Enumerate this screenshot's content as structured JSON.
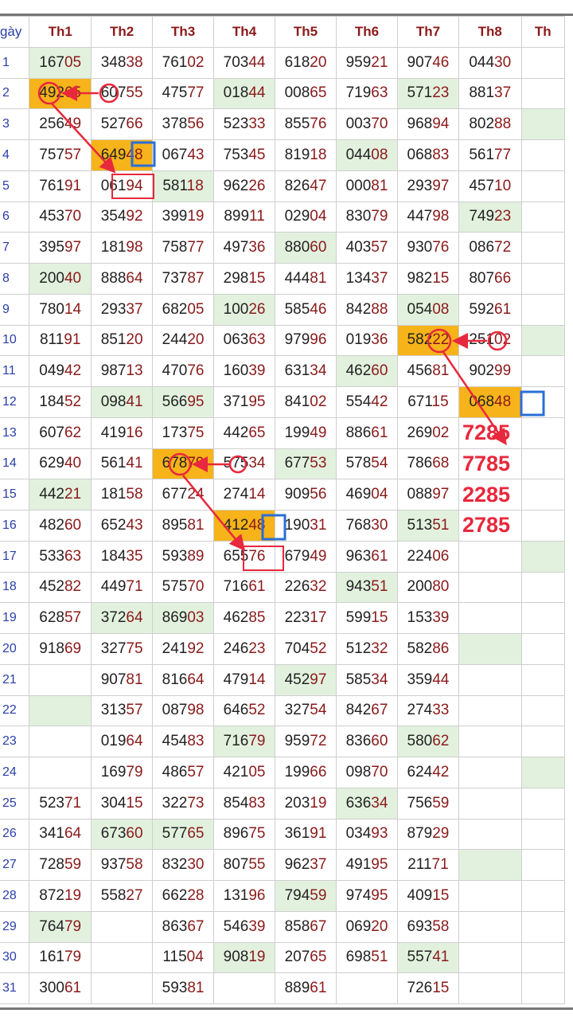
{
  "header": {
    "day_label": "gày",
    "months": [
      "Th1",
      "Th2",
      "Th3",
      "Th4",
      "Th5",
      "Th6",
      "Th7",
      "Th8",
      "Th"
    ]
  },
  "rows": [
    {
      "day": "1",
      "cells": [
        "16705",
        "34838",
        "76102",
        "70344",
        "61820",
        "95921",
        "90746",
        "04430",
        ""
      ]
    },
    {
      "day": "2",
      "cells": [
        "49265",
        "60755",
        "47577",
        "01844",
        "00865",
        "71963",
        "57123",
        "88137",
        ""
      ]
    },
    {
      "day": "3",
      "cells": [
        "25649",
        "52766",
        "37856",
        "52333",
        "85576",
        "00370",
        "96894",
        "80288",
        ""
      ]
    },
    {
      "day": "4",
      "cells": [
        "75757",
        "64948",
        "06743",
        "75345",
        "81918",
        "04408",
        "06883",
        "56177",
        ""
      ]
    },
    {
      "day": "5",
      "cells": [
        "76191",
        "06194",
        "58118",
        "96226",
        "82647",
        "00081",
        "29397",
        "45710",
        ""
      ]
    },
    {
      "day": "6",
      "cells": [
        "45370",
        "35492",
        "39919",
        "89911",
        "02904",
        "83079",
        "44798",
        "74923",
        ""
      ]
    },
    {
      "day": "7",
      "cells": [
        "39597",
        "18198",
        "75877",
        "49736",
        "88060",
        "40357",
        "93076",
        "08672",
        ""
      ]
    },
    {
      "day": "8",
      "cells": [
        "20040",
        "88864",
        "73787",
        "29815",
        "44481",
        "13437",
        "98215",
        "80766",
        ""
      ]
    },
    {
      "day": "9",
      "cells": [
        "78014",
        "29337",
        "68205",
        "10026",
        "58546",
        "84288",
        "05408",
        "59261",
        ""
      ]
    },
    {
      "day": "10",
      "cells": [
        "81191",
        "85120",
        "24420",
        "06363",
        "97996",
        "01936",
        "58222",
        "25102",
        ""
      ]
    },
    {
      "day": "11",
      "cells": [
        "04942",
        "98713",
        "47076",
        "16039",
        "63134",
        "46260",
        "45681",
        "90299",
        ""
      ]
    },
    {
      "day": "12",
      "cells": [
        "18452",
        "09841",
        "56695",
        "37195",
        "84102",
        "55442",
        "67115",
        "06848",
        ""
      ]
    },
    {
      "day": "13",
      "cells": [
        "60762",
        "41916",
        "17375",
        "44265",
        "19949",
        "88661",
        "26902",
        "7285",
        ""
      ]
    },
    {
      "day": "14",
      "cells": [
        "62940",
        "56141",
        "67879",
        "57534",
        "67753",
        "57854",
        "78668",
        "7785",
        ""
      ]
    },
    {
      "day": "15",
      "cells": [
        "44221",
        "18158",
        "67724",
        "27414",
        "90956",
        "46904",
        "08897",
        "2285",
        ""
      ]
    },
    {
      "day": "16",
      "cells": [
        "48260",
        "65243",
        "89581",
        "41248",
        "19031",
        "76830",
        "51351",
        "2785",
        ""
      ]
    },
    {
      "day": "17",
      "cells": [
        "53363",
        "18435",
        "59389",
        "65576",
        "67949",
        "96361",
        "22406",
        "",
        ""
      ]
    },
    {
      "day": "18",
      "cells": [
        "45282",
        "44971",
        "57570",
        "71661",
        "22632",
        "94351",
        "20080",
        "",
        ""
      ]
    },
    {
      "day": "19",
      "cells": [
        "62857",
        "37264",
        "86903",
        "46285",
        "22317",
        "59915",
        "15339",
        "",
        ""
      ]
    },
    {
      "day": "20",
      "cells": [
        "91869",
        "32775",
        "24192",
        "24623",
        "70452",
        "51232",
        "58286",
        "",
        ""
      ]
    },
    {
      "day": "21",
      "cells": [
        "",
        "90781",
        "81664",
        "47914",
        "45297",
        "58534",
        "35944",
        "",
        ""
      ]
    },
    {
      "day": "22",
      "cells": [
        "",
        "31357",
        "08798",
        "64652",
        "32754",
        "84267",
        "27433",
        "",
        ""
      ]
    },
    {
      "day": "23",
      "cells": [
        "",
        "01964",
        "45483",
        "71679",
        "95972",
        "83660",
        "58062",
        "",
        ""
      ]
    },
    {
      "day": "24",
      "cells": [
        "",
        "16979",
        "48657",
        "42105",
        "19966",
        "09870",
        "62442",
        "",
        ""
      ]
    },
    {
      "day": "25",
      "cells": [
        "52371",
        "30415",
        "32273",
        "85483",
        "20319",
        "63634",
        "75659",
        "",
        ""
      ]
    },
    {
      "day": "26",
      "cells": [
        "34164",
        "67360",
        "57765",
        "89675",
        "36191",
        "03493",
        "87929",
        "",
        ""
      ]
    },
    {
      "day": "27",
      "cells": [
        "72859",
        "93758",
        "83230",
        "80755",
        "96237",
        "49195",
        "21171",
        "",
        ""
      ]
    },
    {
      "day": "28",
      "cells": [
        "87219",
        "55827",
        "66228",
        "13196",
        "79459",
        "97495",
        "40915",
        "",
        ""
      ]
    },
    {
      "day": "29",
      "cells": [
        "76479",
        "",
        "86367",
        "54639",
        "85867",
        "06920",
        "69358",
        "",
        ""
      ]
    },
    {
      "day": "30",
      "cells": [
        "16179",
        "",
        "11504",
        "90819",
        "20765",
        "69851",
        "55741",
        "",
        ""
      ]
    },
    {
      "day": "31",
      "cells": [
        "30061",
        "",
        "59381",
        "",
        "88961",
        "",
        "72615",
        "",
        ""
      ]
    }
  ],
  "green_cells": [
    [
      1,
      1
    ],
    [
      2,
      4
    ],
    [
      2,
      7
    ],
    [
      3,
      9
    ],
    [
      4,
      6
    ],
    [
      5,
      3
    ],
    [
      6,
      8
    ],
    [
      7,
      5
    ],
    [
      8,
      1
    ],
    [
      9,
      4
    ],
    [
      9,
      7
    ],
    [
      10,
      9
    ],
    [
      11,
      6
    ],
    [
      12,
      2
    ],
    [
      12,
      3
    ],
    [
      14,
      5
    ],
    [
      15,
      1
    ],
    [
      16,
      7
    ],
    [
      17,
      9
    ],
    [
      18,
      6
    ],
    [
      19,
      2
    ],
    [
      19,
      3
    ],
    [
      20,
      8
    ],
    [
      21,
      5
    ],
    [
      22,
      1
    ],
    [
      23,
      4
    ],
    [
      23,
      7
    ],
    [
      24,
      9
    ],
    [
      25,
      6
    ],
    [
      26,
      2
    ],
    [
      26,
      3
    ],
    [
      27,
      8
    ],
    [
      28,
      5
    ],
    [
      29,
      1
    ],
    [
      30,
      4
    ],
    [
      30,
      7
    ]
  ],
  "orange_cells": [
    [
      2,
      1
    ],
    [
      4,
      2
    ],
    [
      10,
      7
    ],
    [
      12,
      8
    ],
    [
      14,
      3
    ],
    [
      16,
      4
    ]
  ],
  "colors": {
    "green": "#e2f1de",
    "orange": "#f6b31a",
    "header_text": "#8b1a1a",
    "day_text": "#2a3fa8",
    "annotation": "#e8283c",
    "box_blue": "#2a6fd6"
  }
}
